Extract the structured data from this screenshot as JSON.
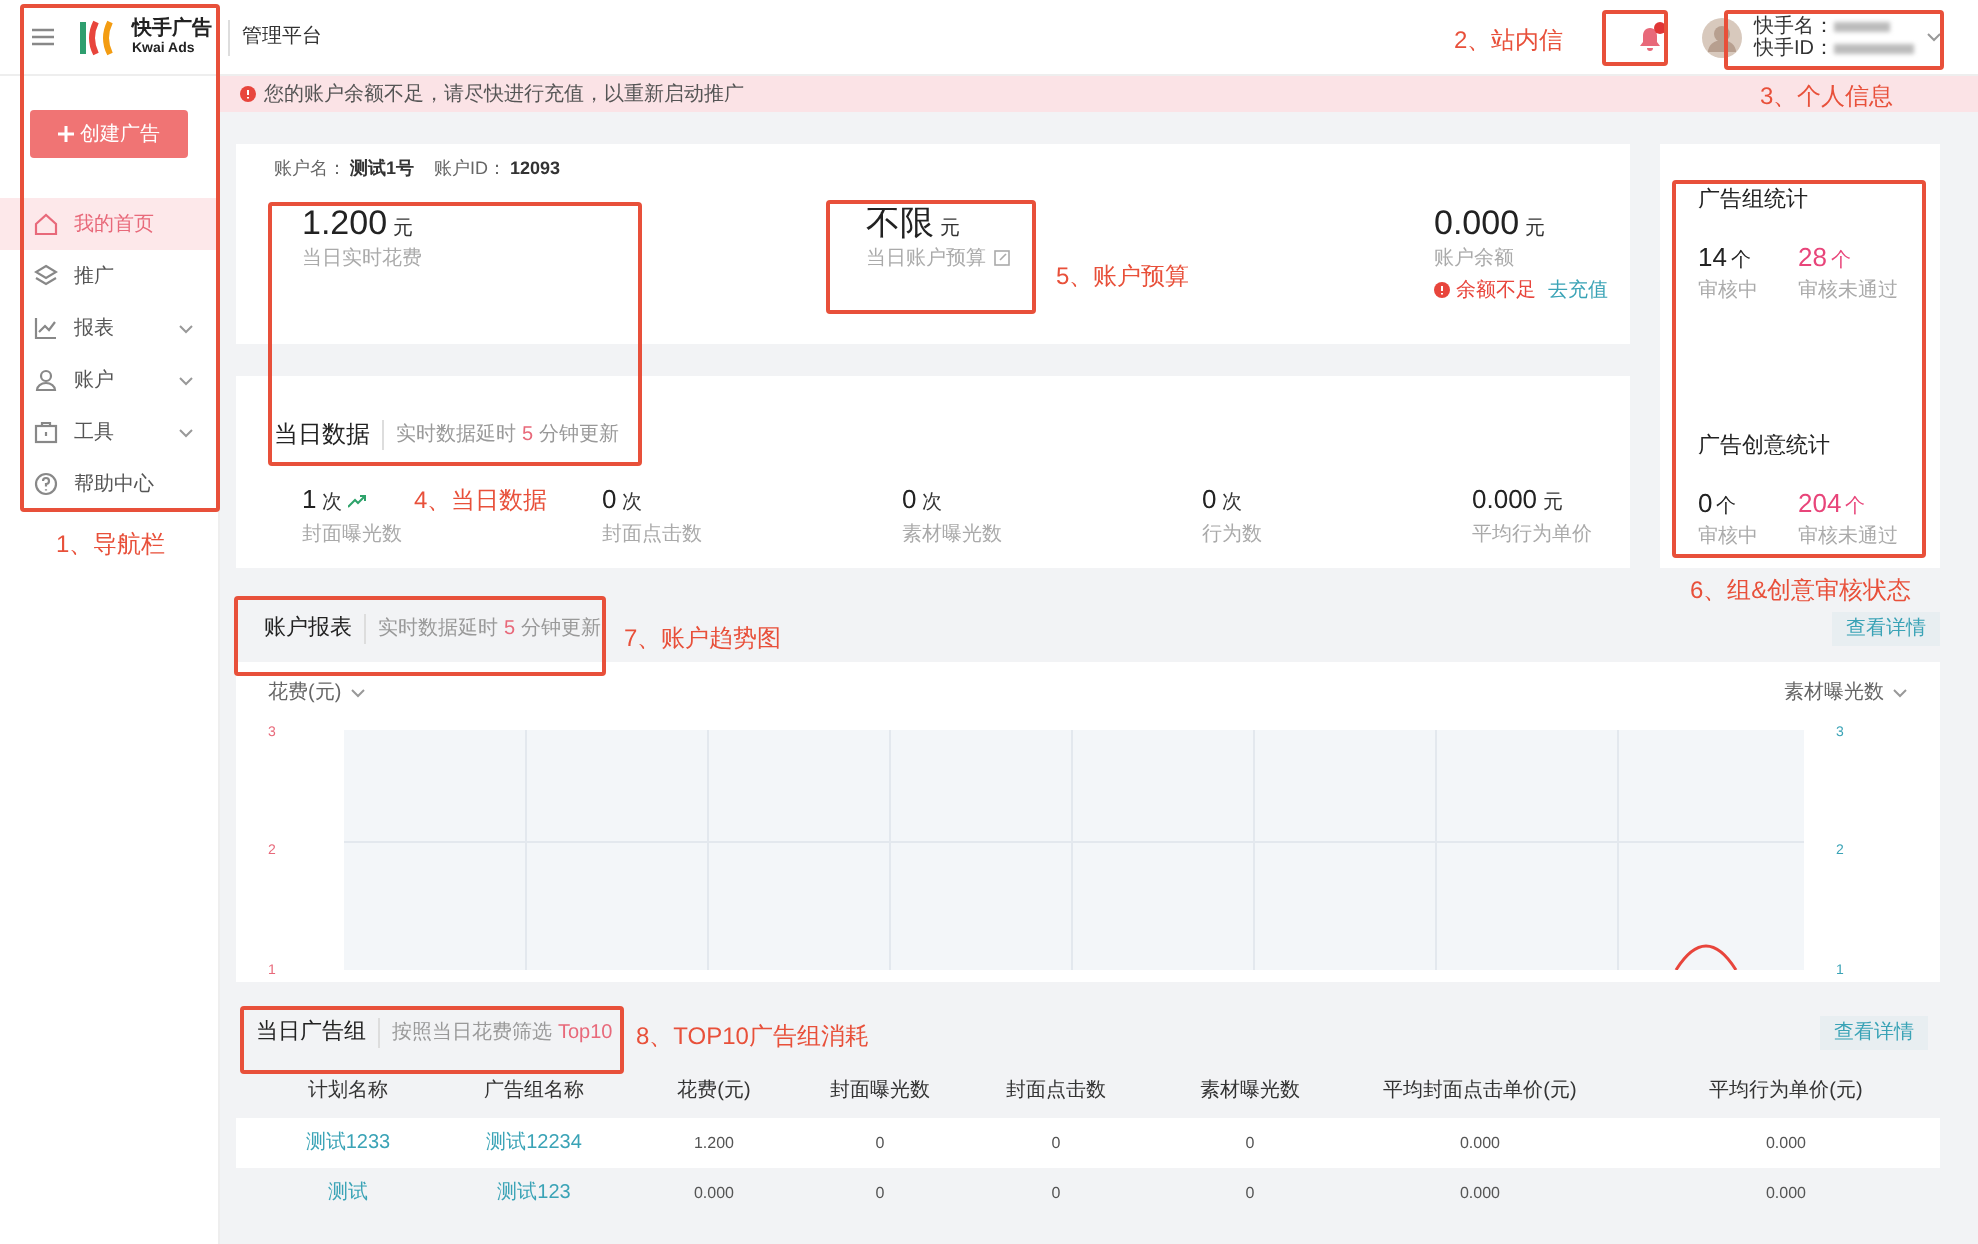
{
  "header": {
    "logo_text": "快手广告",
    "logo_subtext": "Kwai Ads",
    "platform": "管理平台",
    "notification_unread": true,
    "user": {
      "name_label": "快手名：",
      "id_label": "快手ID："
    }
  },
  "alert": {
    "text": "您的账户余额不足，请尽快进行充值，以重新启动推广"
  },
  "sidebar": {
    "create_button": "创建广告",
    "items": [
      {
        "label": "我的首页",
        "selected": true,
        "expandable": false
      },
      {
        "label": "推广",
        "selected": false,
        "expandable": false
      },
      {
        "label": "报表",
        "selected": false,
        "expandable": true
      },
      {
        "label": "账户",
        "selected": false,
        "expandable": true
      },
      {
        "label": "工具",
        "selected": false,
        "expandable": true
      },
      {
        "label": "帮助中心",
        "selected": false,
        "expandable": false
      }
    ]
  },
  "account": {
    "name_label": "账户名：",
    "name": "测试1号",
    "id_label": "账户ID：",
    "id": "12093",
    "stats": [
      {
        "kind": "plain",
        "value": "1.200",
        "unit": "元",
        "label": "当日实时花费"
      },
      {
        "kind": "editable",
        "value": "不限",
        "unit": "元",
        "label": "当日账户预算"
      },
      {
        "kind": "balance",
        "value": "0.000",
        "unit": "元",
        "label": "账户余额",
        "warning": "余额不足",
        "link": "去充值"
      }
    ]
  },
  "today": {
    "title": "当日数据",
    "note_before": "实时数据延时",
    "note_delay": "5",
    "note_after": "分钟更新",
    "metrics": [
      {
        "value": "1",
        "unit": "次",
        "label": "封面曝光数",
        "trend_up": true
      },
      {
        "value": "0",
        "unit": "次",
        "label": "封面点击数",
        "trend_up": false
      },
      {
        "value": "0",
        "unit": "次",
        "label": "素材曝光数",
        "trend_up": false
      },
      {
        "value": "0",
        "unit": "次",
        "label": "行为数",
        "trend_up": false
      },
      {
        "value": "0.000",
        "unit": "元",
        "label": "平均行为单价",
        "trend_up": false
      }
    ]
  },
  "review_stats": [
    {
      "title": "广告组统计",
      "reviewing": "14",
      "reviewing_unit": "个",
      "reviewing_label": "审核中",
      "rejected": "28",
      "rejected_unit": "个",
      "rejected_label": "审核未通过"
    },
    {
      "title": "广告创意统计",
      "reviewing": "0",
      "reviewing_unit": "个",
      "reviewing_label": "审核中",
      "rejected": "204",
      "rejected_unit": "个",
      "rejected_label": "审核未通过"
    }
  ],
  "report": {
    "title": "账户报表",
    "note_before": "实时数据延时",
    "note_delay": "5",
    "note_after": "分钟更新",
    "detail_button": "查看详情",
    "left_metric": "花费(元)",
    "right_metric": "素材曝光数",
    "left_ticks": [
      "3",
      "2",
      "1"
    ],
    "right_ticks": [
      "3",
      "2",
      "1"
    ]
  },
  "ad_groups": {
    "title": "当日广告组",
    "note_before": "按照当日花费筛选",
    "note_highlight": "Top10",
    "detail_button": "查看详情",
    "columns": [
      "计划名称",
      "广告组名称",
      "花费(元)",
      "封面曝光数",
      "封面点击数",
      "素材曝光数",
      "平均封面点击单价(元)",
      "平均行为单价(元)"
    ],
    "rows": [
      [
        "测试1233",
        "测试12234",
        "1.200",
        "0",
        "0",
        "0",
        "0.000",
        "0.000"
      ],
      [
        "测试",
        "测试123",
        "0.000",
        "0",
        "0",
        "0",
        "0.000",
        "0.000"
      ]
    ]
  },
  "annotations": [
    {
      "label": "1、导航栏"
    },
    {
      "label": "2、站内信"
    },
    {
      "label": "3、个人信息"
    },
    {
      "label": "4、当日数据"
    },
    {
      "label": "5、账户预算"
    },
    {
      "label": "6、组&创意审核状态"
    },
    {
      "label": "7、账户趋势图"
    },
    {
      "label": "8、TOP10广告组消耗"
    }
  ]
}
